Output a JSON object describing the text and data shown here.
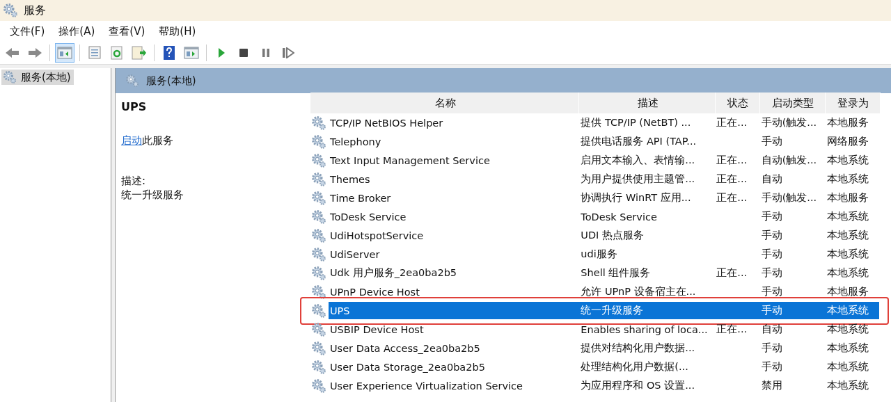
{
  "window": {
    "title": "服务"
  },
  "menu": [
    {
      "label": "文件(F)"
    },
    {
      "label": "操作(A)"
    },
    {
      "label": "查看(V)"
    },
    {
      "label": "帮助(H)"
    }
  ],
  "toolbar": {
    "groups": [
      [
        {
          "kind": "back",
          "pressed": false
        },
        {
          "kind": "forward",
          "pressed": false
        }
      ],
      [
        {
          "kind": "tree",
          "pressed": true
        }
      ],
      [
        {
          "kind": "properties",
          "pressed": false
        },
        {
          "kind": "refresh",
          "pressed": false
        },
        {
          "kind": "export",
          "pressed": false
        }
      ],
      [
        {
          "kind": "help",
          "pressed": false
        },
        {
          "kind": "pane",
          "pressed": false
        }
      ],
      [
        {
          "kind": "start",
          "pressed": false
        },
        {
          "kind": "stop",
          "pressed": false
        },
        {
          "kind": "pause",
          "pressed": false
        },
        {
          "kind": "resume",
          "pressed": false
        }
      ]
    ]
  },
  "tree": {
    "items": [
      {
        "label": "服务(本地)",
        "selected": true
      }
    ]
  },
  "panel": {
    "title": "服务(本地)"
  },
  "detail": {
    "name": "UPS",
    "action_link": "启动",
    "action_text": "此服务",
    "description_label": "描述:",
    "description": "统一升级服务"
  },
  "table": {
    "columns": [
      "名称",
      "描述",
      "状态",
      "启动类型",
      "登录为"
    ],
    "rows": [
      {
        "name": "TCP/IP NetBIOS Helper",
        "description": "提供 TCP/IP (NetBT) ...",
        "status": "正在...",
        "startup": "手动(触发...",
        "logon": "本地服务",
        "selected": false
      },
      {
        "name": "Telephony",
        "description": "提供电话服务 API (TAP...",
        "status": "",
        "startup": "手动",
        "logon": "网络服务",
        "selected": false
      },
      {
        "name": "Text Input Management Service",
        "description": "启用文本输入、表情输...",
        "status": "正在...",
        "startup": "自动(触发...",
        "logon": "本地系统",
        "selected": false
      },
      {
        "name": "Themes",
        "description": "为用户提供使用主题管...",
        "status": "正在...",
        "startup": "自动",
        "logon": "本地系统",
        "selected": false
      },
      {
        "name": "Time Broker",
        "description": "协调执行 WinRT 应用...",
        "status": "正在...",
        "startup": "手动(触发...",
        "logon": "本地服务",
        "selected": false
      },
      {
        "name": "ToDesk Service",
        "description": "ToDesk Service",
        "status": "",
        "startup": "手动",
        "logon": "本地系统",
        "selected": false
      },
      {
        "name": "UdiHotspotService",
        "description": "UDI 热点服务",
        "status": "",
        "startup": "手动",
        "logon": "本地系统",
        "selected": false
      },
      {
        "name": "UdiServer",
        "description": "udi服务",
        "status": "",
        "startup": "手动",
        "logon": "本地系统",
        "selected": false
      },
      {
        "name": "Udk 用户服务_2ea0ba2b5",
        "description": "Shell 组件服务",
        "status": "正在...",
        "startup": "手动",
        "logon": "本地系统",
        "selected": false
      },
      {
        "name": "UPnP Device Host",
        "description": "允许 UPnP 设备宿主在...",
        "status": "",
        "startup": "手动",
        "logon": "本地服务",
        "selected": false
      },
      {
        "name": "UPS",
        "description": "统一升级服务",
        "status": "",
        "startup": "手动",
        "logon": "本地系统",
        "selected": true
      },
      {
        "name": "USBIP Device Host",
        "description": "Enables sharing of loca...",
        "status": "正在...",
        "startup": "自动",
        "logon": "本地系统",
        "selected": false
      },
      {
        "name": "User Data Access_2ea0ba2b5",
        "description": "提供对结构化用户数据...",
        "status": "",
        "startup": "手动",
        "logon": "本地系统",
        "selected": false
      },
      {
        "name": "User Data Storage_2ea0ba2b5",
        "description": "处理结构化用户数据(...",
        "status": "",
        "startup": "手动",
        "logon": "本地系统",
        "selected": false
      },
      {
        "name": "User Experience Virtualization Service",
        "description": "为应用程序和 OS 设置...",
        "status": "",
        "startup": "禁用",
        "logon": "本地系统",
        "selected": false
      }
    ]
  }
}
